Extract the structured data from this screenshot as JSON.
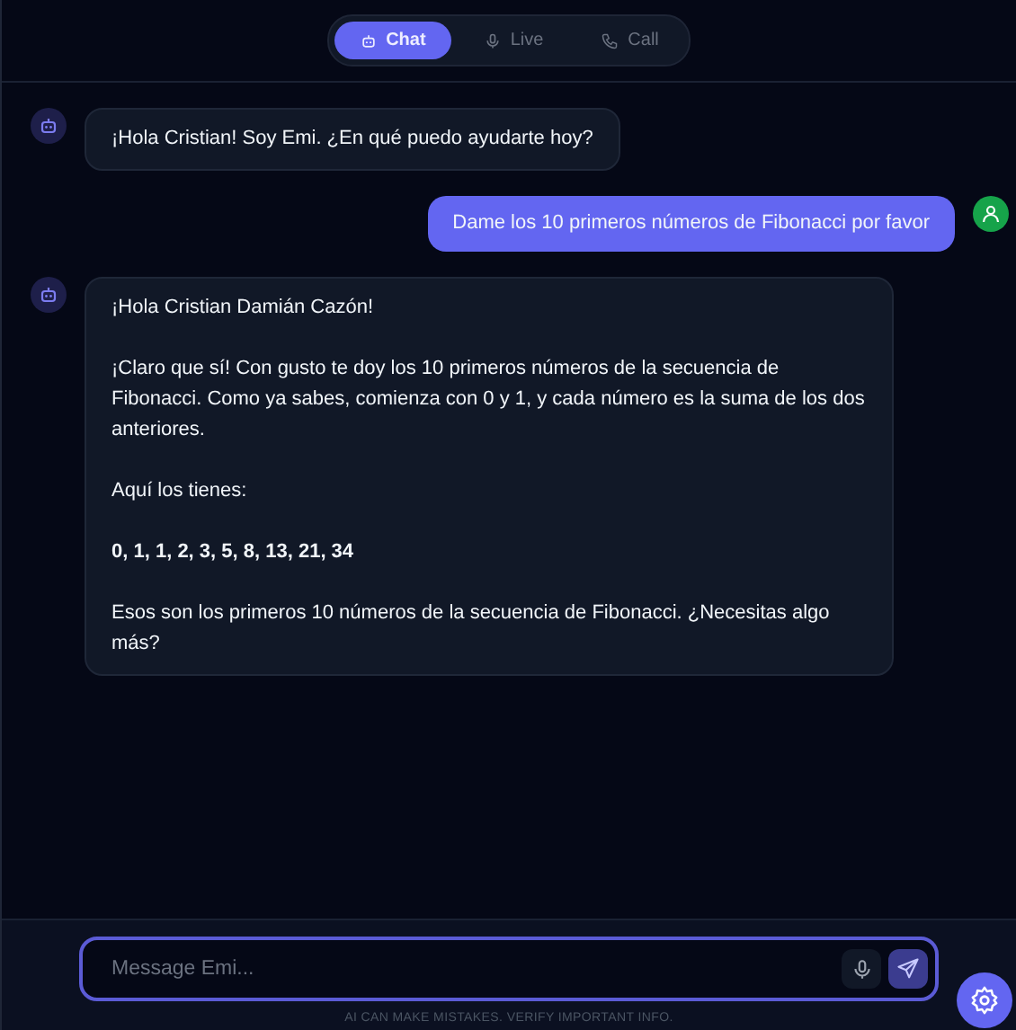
{
  "tabs": [
    {
      "label": "Chat",
      "selected": true
    },
    {
      "label": "Live",
      "selected": false
    },
    {
      "label": "Call",
      "selected": false
    }
  ],
  "messages": [
    {
      "kind": "bot",
      "paragraphs": [
        {
          "text": "¡Hola Cristian! Soy Emi. ¿En qué puedo ayudarte hoy?",
          "bold": false
        }
      ]
    },
    {
      "kind": "user",
      "paragraphs": [
        {
          "text": "Dame los 10 primeros números de Fibonacci por favor",
          "bold": false
        }
      ]
    },
    {
      "kind": "bot",
      "paragraphs": [
        {
          "text": "¡Hola Cristian Damián Cazón!",
          "bold": false
        },
        {
          "text": "¡Claro que sí! Con gusto te doy los 10 primeros números de la secuencia de Fibonacci. Como ya sabes, comienza con 0 y 1, y cada número es la suma de los dos anteriores.",
          "bold": false
        },
        {
          "text": "Aquí los tienes:",
          "bold": false
        },
        {
          "text": "0, 1, 1, 2, 3, 5, 8, 13, 21, 34",
          "bold": true
        },
        {
          "text": "Esos son los primeros 10 números de la secuencia de Fibonacci. ¿Necesitas algo más?",
          "bold": false
        }
      ]
    }
  ],
  "composer": {
    "placeholder": "Message Emi..."
  },
  "disclaimer": "AI CAN MAKE MISTAKES. VERIFY IMPORTANT INFO."
}
